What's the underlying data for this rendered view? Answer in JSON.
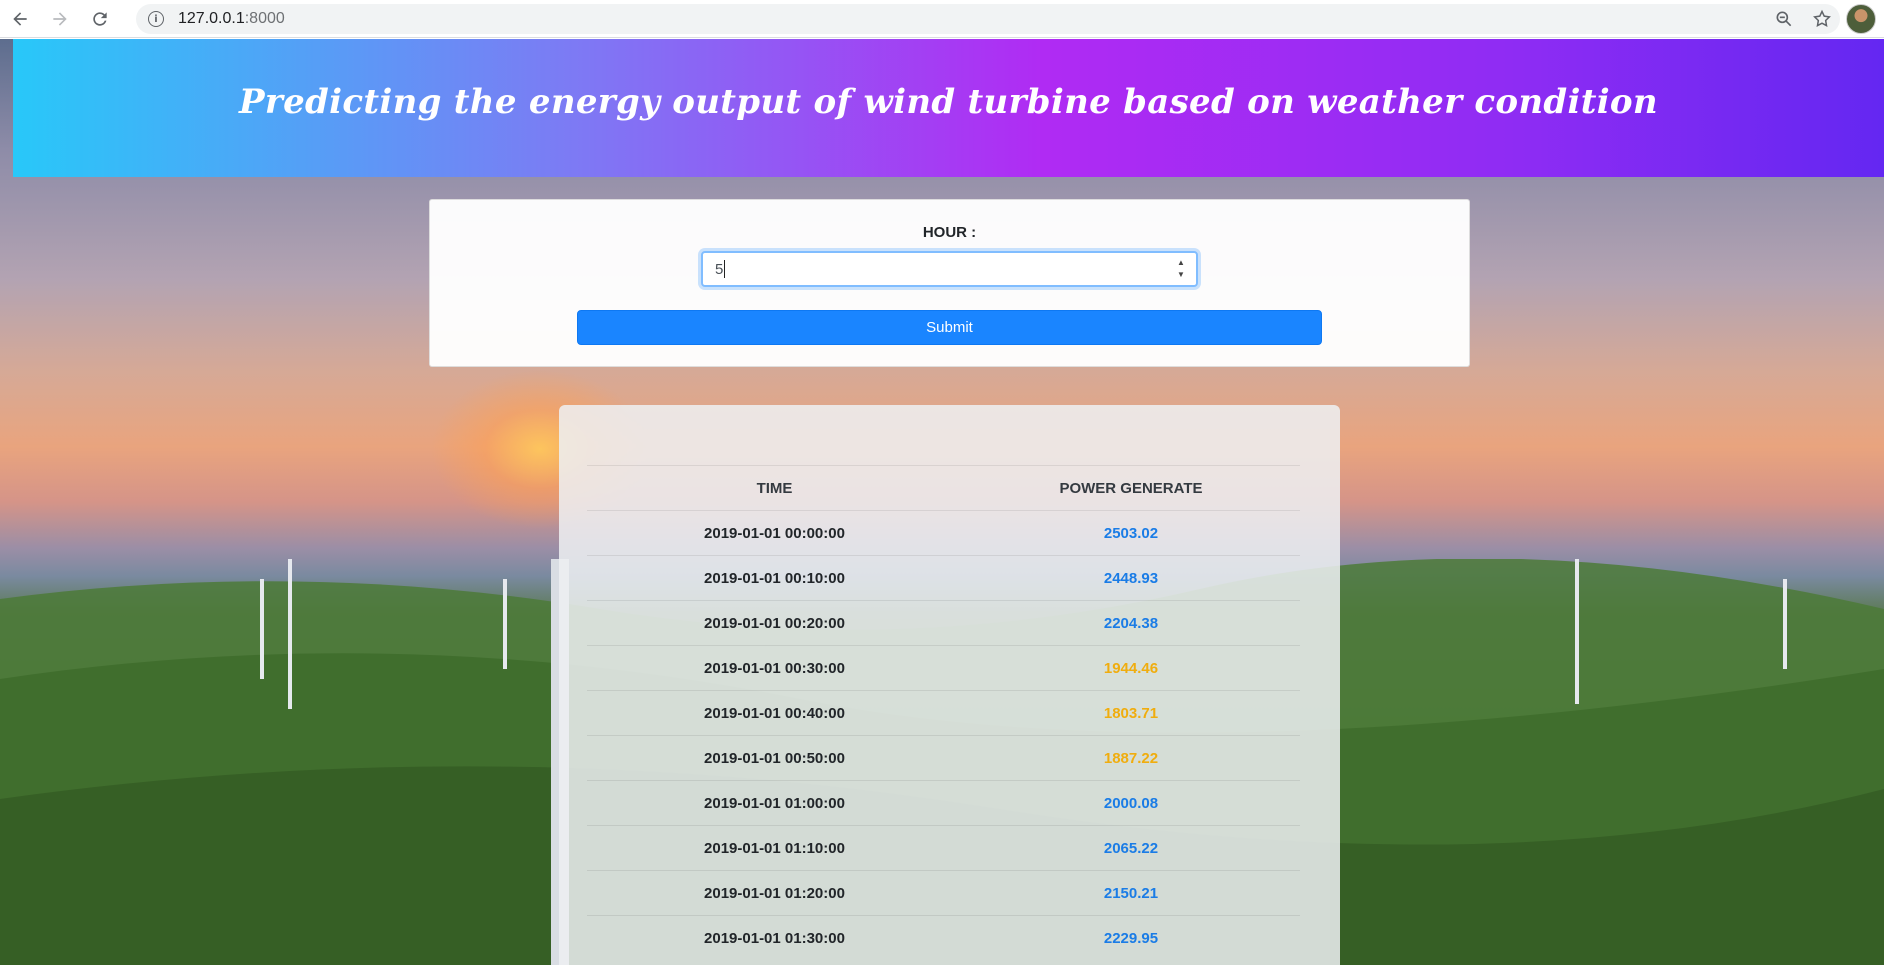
{
  "browser": {
    "url_host": "127.0.0.1",
    "url_port": ":8000"
  },
  "header": {
    "title": "Predicting the energy output of wind turbine based on weather condition"
  },
  "form": {
    "label": "HOUR :",
    "input_value": "5",
    "submit_label": "Submit"
  },
  "table": {
    "headers": [
      "TIME",
      "POWER GENERATE"
    ],
    "rows": [
      {
        "time": "2019-01-01 00:00:00",
        "power": "2503.02",
        "level": "blue"
      },
      {
        "time": "2019-01-01 00:10:00",
        "power": "2448.93",
        "level": "blue"
      },
      {
        "time": "2019-01-01 00:20:00",
        "power": "2204.38",
        "level": "blue"
      },
      {
        "time": "2019-01-01 00:30:00",
        "power": "1944.46",
        "level": "amber"
      },
      {
        "time": "2019-01-01 00:40:00",
        "power": "1803.71",
        "level": "amber"
      },
      {
        "time": "2019-01-01 00:50:00",
        "power": "1887.22",
        "level": "amber"
      },
      {
        "time": "2019-01-01 01:00:00",
        "power": "2000.08",
        "level": "blue"
      },
      {
        "time": "2019-01-01 01:10:00",
        "power": "2065.22",
        "level": "blue"
      },
      {
        "time": "2019-01-01 01:20:00",
        "power": "2150.21",
        "level": "blue"
      },
      {
        "time": "2019-01-01 01:30:00",
        "power": "2229.95",
        "level": "blue"
      }
    ]
  },
  "colors": {
    "high_power": "#1a7ce6",
    "low_power": "#f0ad0e",
    "submit": "#1a85ff"
  }
}
